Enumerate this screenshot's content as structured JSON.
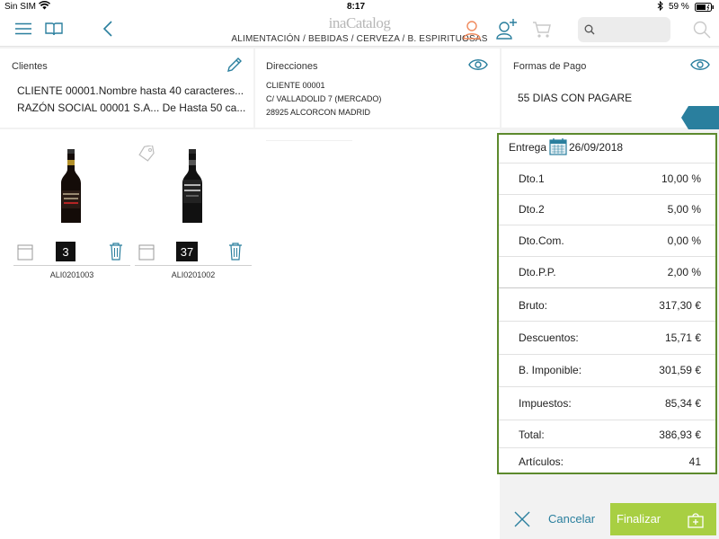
{
  "status_bar": {
    "carrier": "Sin SIM",
    "time": "8:17",
    "battery": "59 %"
  },
  "nav": {
    "brand": "inaCatalog",
    "breadcrumb": "ALIMENTACIÓN / BEBIDAS / CERVEZA / B. ESPIRITUOSAS",
    "colors": {
      "accent": "#2a7f9e",
      "user": "#f08a5d"
    }
  },
  "cards": {
    "clientes": {
      "title": "Clientes",
      "line1": "CLIENTE 00001.Nombre hasta 40 caracteres...",
      "line2": "RAZÓN SOCIAL  00001 S.A... De  Hasta 50 ca..."
    },
    "direcciones": {
      "title": "Direcciones",
      "line1": "CLIENTE 00001",
      "line2": "C/ VALLADOLID 7 (MERCADO)",
      "line3": "28925 ALCORCON MADRID"
    },
    "formas_pago": {
      "title": "Formas de Pago",
      "value": "55 DIAS CON PAGARE"
    }
  },
  "products": [
    {
      "code": "ALI0201003",
      "quantity": "3"
    },
    {
      "code": "ALI0201002",
      "quantity": "37"
    }
  ],
  "summary": {
    "entrega_label": "Entrega",
    "entrega_date": "26/09/2018",
    "rows": [
      {
        "label": "Dto.1",
        "value": "10,00  %"
      },
      {
        "label": "Dto.2",
        "value": "5,00  %"
      },
      {
        "label": "Dto.Com.",
        "value": "0,00  %"
      },
      {
        "label": "Dto.P.P.",
        "value": "2,00  %"
      },
      {
        "label": "Bruto:",
        "value": "317,30 €"
      },
      {
        "label": "Descuentos:",
        "value": "15,71 €"
      },
      {
        "label": "B. Imponible:",
        "value": "301,59 €"
      },
      {
        "label": "Impuestos:",
        "value": "85,34 €"
      },
      {
        "label": "Total:",
        "value": "386,93 €"
      },
      {
        "label": "Artículos:",
        "value": "41"
      }
    ],
    "border_color": "#5d8a2d"
  },
  "footer": {
    "cancel_label": "Cancelar",
    "finalize_label": "Finalizar",
    "finalize_color": "#a8cf42"
  }
}
